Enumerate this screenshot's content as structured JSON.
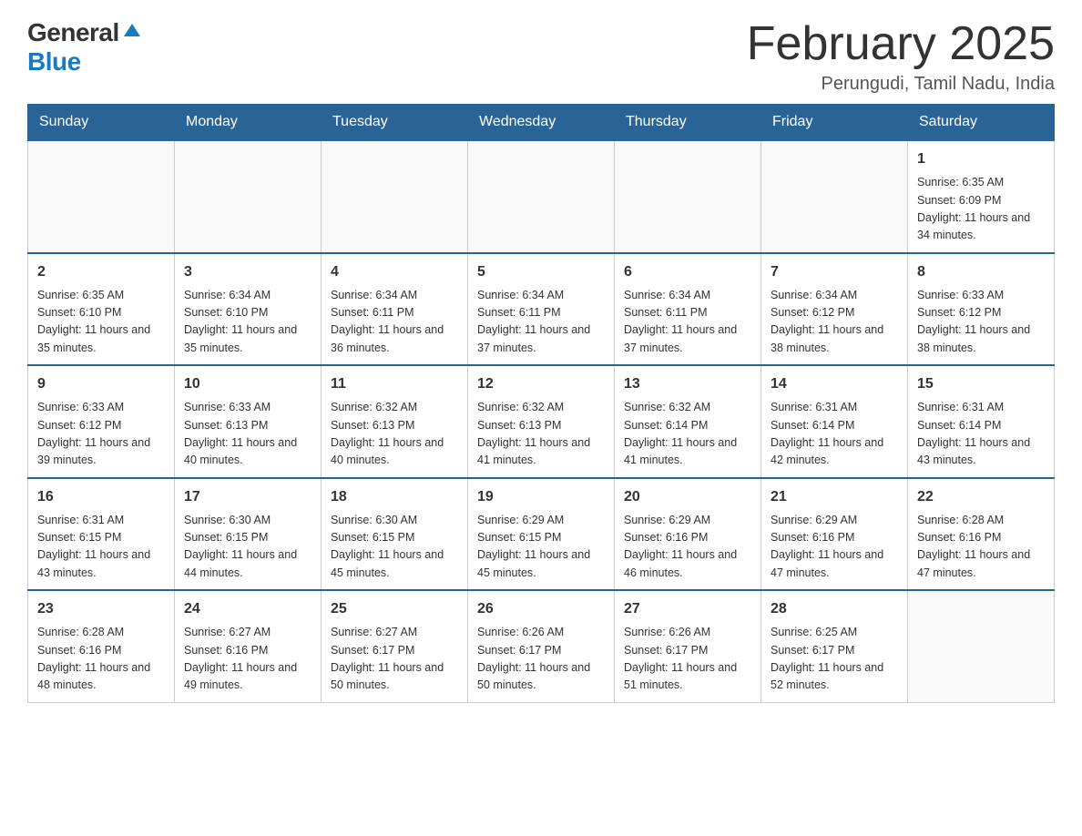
{
  "logo": {
    "general": "General",
    "blue": "Blue"
  },
  "header": {
    "title": "February 2025",
    "location": "Perungudi, Tamil Nadu, India"
  },
  "weekdays": [
    "Sunday",
    "Monday",
    "Tuesday",
    "Wednesday",
    "Thursday",
    "Friday",
    "Saturday"
  ],
  "weeks": [
    [
      {
        "day": "",
        "info": ""
      },
      {
        "day": "",
        "info": ""
      },
      {
        "day": "",
        "info": ""
      },
      {
        "day": "",
        "info": ""
      },
      {
        "day": "",
        "info": ""
      },
      {
        "day": "",
        "info": ""
      },
      {
        "day": "1",
        "info": "Sunrise: 6:35 AM\nSunset: 6:09 PM\nDaylight: 11 hours and 34 minutes."
      }
    ],
    [
      {
        "day": "2",
        "info": "Sunrise: 6:35 AM\nSunset: 6:10 PM\nDaylight: 11 hours and 35 minutes."
      },
      {
        "day": "3",
        "info": "Sunrise: 6:34 AM\nSunset: 6:10 PM\nDaylight: 11 hours and 35 minutes."
      },
      {
        "day": "4",
        "info": "Sunrise: 6:34 AM\nSunset: 6:11 PM\nDaylight: 11 hours and 36 minutes."
      },
      {
        "day": "5",
        "info": "Sunrise: 6:34 AM\nSunset: 6:11 PM\nDaylight: 11 hours and 37 minutes."
      },
      {
        "day": "6",
        "info": "Sunrise: 6:34 AM\nSunset: 6:11 PM\nDaylight: 11 hours and 37 minutes."
      },
      {
        "day": "7",
        "info": "Sunrise: 6:34 AM\nSunset: 6:12 PM\nDaylight: 11 hours and 38 minutes."
      },
      {
        "day": "8",
        "info": "Sunrise: 6:33 AM\nSunset: 6:12 PM\nDaylight: 11 hours and 38 minutes."
      }
    ],
    [
      {
        "day": "9",
        "info": "Sunrise: 6:33 AM\nSunset: 6:12 PM\nDaylight: 11 hours and 39 minutes."
      },
      {
        "day": "10",
        "info": "Sunrise: 6:33 AM\nSunset: 6:13 PM\nDaylight: 11 hours and 40 minutes."
      },
      {
        "day": "11",
        "info": "Sunrise: 6:32 AM\nSunset: 6:13 PM\nDaylight: 11 hours and 40 minutes."
      },
      {
        "day": "12",
        "info": "Sunrise: 6:32 AM\nSunset: 6:13 PM\nDaylight: 11 hours and 41 minutes."
      },
      {
        "day": "13",
        "info": "Sunrise: 6:32 AM\nSunset: 6:14 PM\nDaylight: 11 hours and 41 minutes."
      },
      {
        "day": "14",
        "info": "Sunrise: 6:31 AM\nSunset: 6:14 PM\nDaylight: 11 hours and 42 minutes."
      },
      {
        "day": "15",
        "info": "Sunrise: 6:31 AM\nSunset: 6:14 PM\nDaylight: 11 hours and 43 minutes."
      }
    ],
    [
      {
        "day": "16",
        "info": "Sunrise: 6:31 AM\nSunset: 6:15 PM\nDaylight: 11 hours and 43 minutes."
      },
      {
        "day": "17",
        "info": "Sunrise: 6:30 AM\nSunset: 6:15 PM\nDaylight: 11 hours and 44 minutes."
      },
      {
        "day": "18",
        "info": "Sunrise: 6:30 AM\nSunset: 6:15 PM\nDaylight: 11 hours and 45 minutes."
      },
      {
        "day": "19",
        "info": "Sunrise: 6:29 AM\nSunset: 6:15 PM\nDaylight: 11 hours and 45 minutes."
      },
      {
        "day": "20",
        "info": "Sunrise: 6:29 AM\nSunset: 6:16 PM\nDaylight: 11 hours and 46 minutes."
      },
      {
        "day": "21",
        "info": "Sunrise: 6:29 AM\nSunset: 6:16 PM\nDaylight: 11 hours and 47 minutes."
      },
      {
        "day": "22",
        "info": "Sunrise: 6:28 AM\nSunset: 6:16 PM\nDaylight: 11 hours and 47 minutes."
      }
    ],
    [
      {
        "day": "23",
        "info": "Sunrise: 6:28 AM\nSunset: 6:16 PM\nDaylight: 11 hours and 48 minutes."
      },
      {
        "day": "24",
        "info": "Sunrise: 6:27 AM\nSunset: 6:16 PM\nDaylight: 11 hours and 49 minutes."
      },
      {
        "day": "25",
        "info": "Sunrise: 6:27 AM\nSunset: 6:17 PM\nDaylight: 11 hours and 50 minutes."
      },
      {
        "day": "26",
        "info": "Sunrise: 6:26 AM\nSunset: 6:17 PM\nDaylight: 11 hours and 50 minutes."
      },
      {
        "day": "27",
        "info": "Sunrise: 6:26 AM\nSunset: 6:17 PM\nDaylight: 11 hours and 51 minutes."
      },
      {
        "day": "28",
        "info": "Sunrise: 6:25 AM\nSunset: 6:17 PM\nDaylight: 11 hours and 52 minutes."
      },
      {
        "day": "",
        "info": ""
      }
    ]
  ]
}
